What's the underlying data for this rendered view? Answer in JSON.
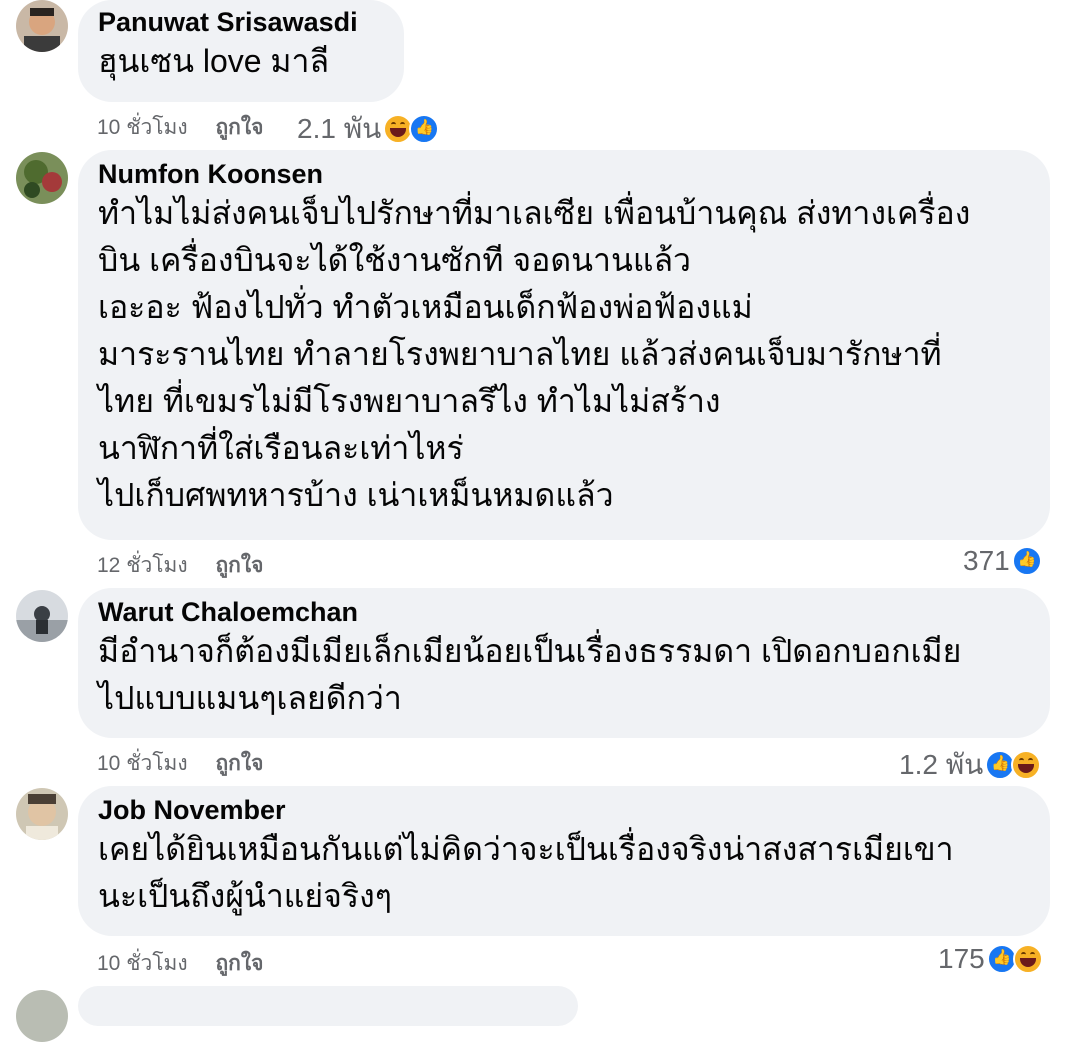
{
  "comments": [
    {
      "author": "Panuwat Srisawasdi",
      "lines": [
        "ฮุนเซน love มาลี"
      ],
      "time": "10 ชั่วโมง",
      "like": "ถูกใจ",
      "reactions_count": "2.1 พัน",
      "reaction_icons": [
        "haha-icon",
        "like-icon"
      ]
    },
    {
      "author": "Numfon Koonsen",
      "lines": [
        "ทำไมไม่ส่งคนเจ็บไปรักษาที่มาเลเซีย เพื่อนบ้านคุณ ส่งทางเครื่อง",
        "บิน เครื่องบินจะได้ใช้งานซักที จอดนานแล้ว",
        "เอะอะ ฟ้องไปทั่ว ทำตัวเหมือนเด็กฟ้องพ่อฟ้องแม่",
        "มาระรานไทย ทำลายโรงพยาบาลไทย แล้วส่งคนเจ็บมารักษาที่",
        "ไทย ที่เขมรไม่มีโรงพยาบาลรึไง ทำไมไม่สร้าง",
        "นาฬิกาที่ใส่เรือนละเท่าไหร่",
        "ไปเก็บศพทหารบ้าง เน่าเหม็นหมดแล้ว"
      ],
      "time": "12 ชั่วโมง",
      "like": "ถูกใจ",
      "reactions_count": "371",
      "reaction_icons": [
        "like-icon"
      ]
    },
    {
      "author": "Warut Chaloemchan",
      "lines": [
        "มีอำนาจก็ต้องมีเมียเล็กเมียน้อยเป็นเรื่องธรรมดา เปิดอกบอกเมีย",
        "ไปแบบแมนๆเลยดีกว่า"
      ],
      "time": "10 ชั่วโมง",
      "like": "ถูกใจ",
      "reactions_count": "1.2 พัน",
      "reaction_icons": [
        "like-icon",
        "haha-icon"
      ]
    },
    {
      "author": "Job November",
      "lines": [
        "เคยได้ยินเหมือนกันแต่ไม่คิดว่าจะเป็นเรื่องจริงน่าสงสารเมียเขา",
        "นะเป็นถึงผู้นำแย่จริงๆ"
      ],
      "time": "10 ชั่วโมง",
      "like": "ถูกใจ",
      "reactions_count": "175",
      "reaction_icons": [
        "like-icon",
        "haha-icon"
      ]
    }
  ]
}
